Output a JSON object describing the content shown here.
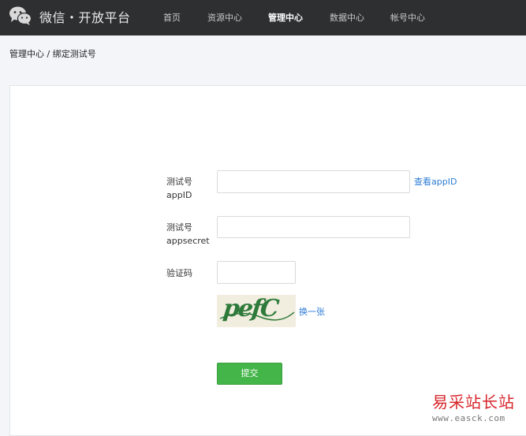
{
  "header": {
    "brand": "微信・开放平台",
    "nav": [
      "首页",
      "资源中心",
      "管理中心",
      "数据中心",
      "帐号中心"
    ],
    "active_nav": "管理中心"
  },
  "breadcrumb": "管理中心 / 绑定测试号",
  "form": {
    "appid_label_line1": "测试号",
    "appid_label_line2": "appID",
    "appid_value": "",
    "view_appid_link": "查看appID",
    "secret_label_line1": "测试号",
    "secret_label_line2": "appsecret",
    "secret_value": "",
    "captcha_label": "验证码",
    "captcha_value": "",
    "captcha_image_text": "pefC",
    "refresh_captcha_link": "换一张",
    "submit_label": "提交"
  },
  "watermark": {
    "text": "易采站长站",
    "url": "www.easck.com"
  },
  "colors": {
    "header_bg": "#2e2f31",
    "accent_green": "#44b549",
    "link_blue": "#2b7bd6",
    "watermark_red": "#d8252b"
  },
  "icons": {
    "logo": "wechat-logo-icon"
  }
}
